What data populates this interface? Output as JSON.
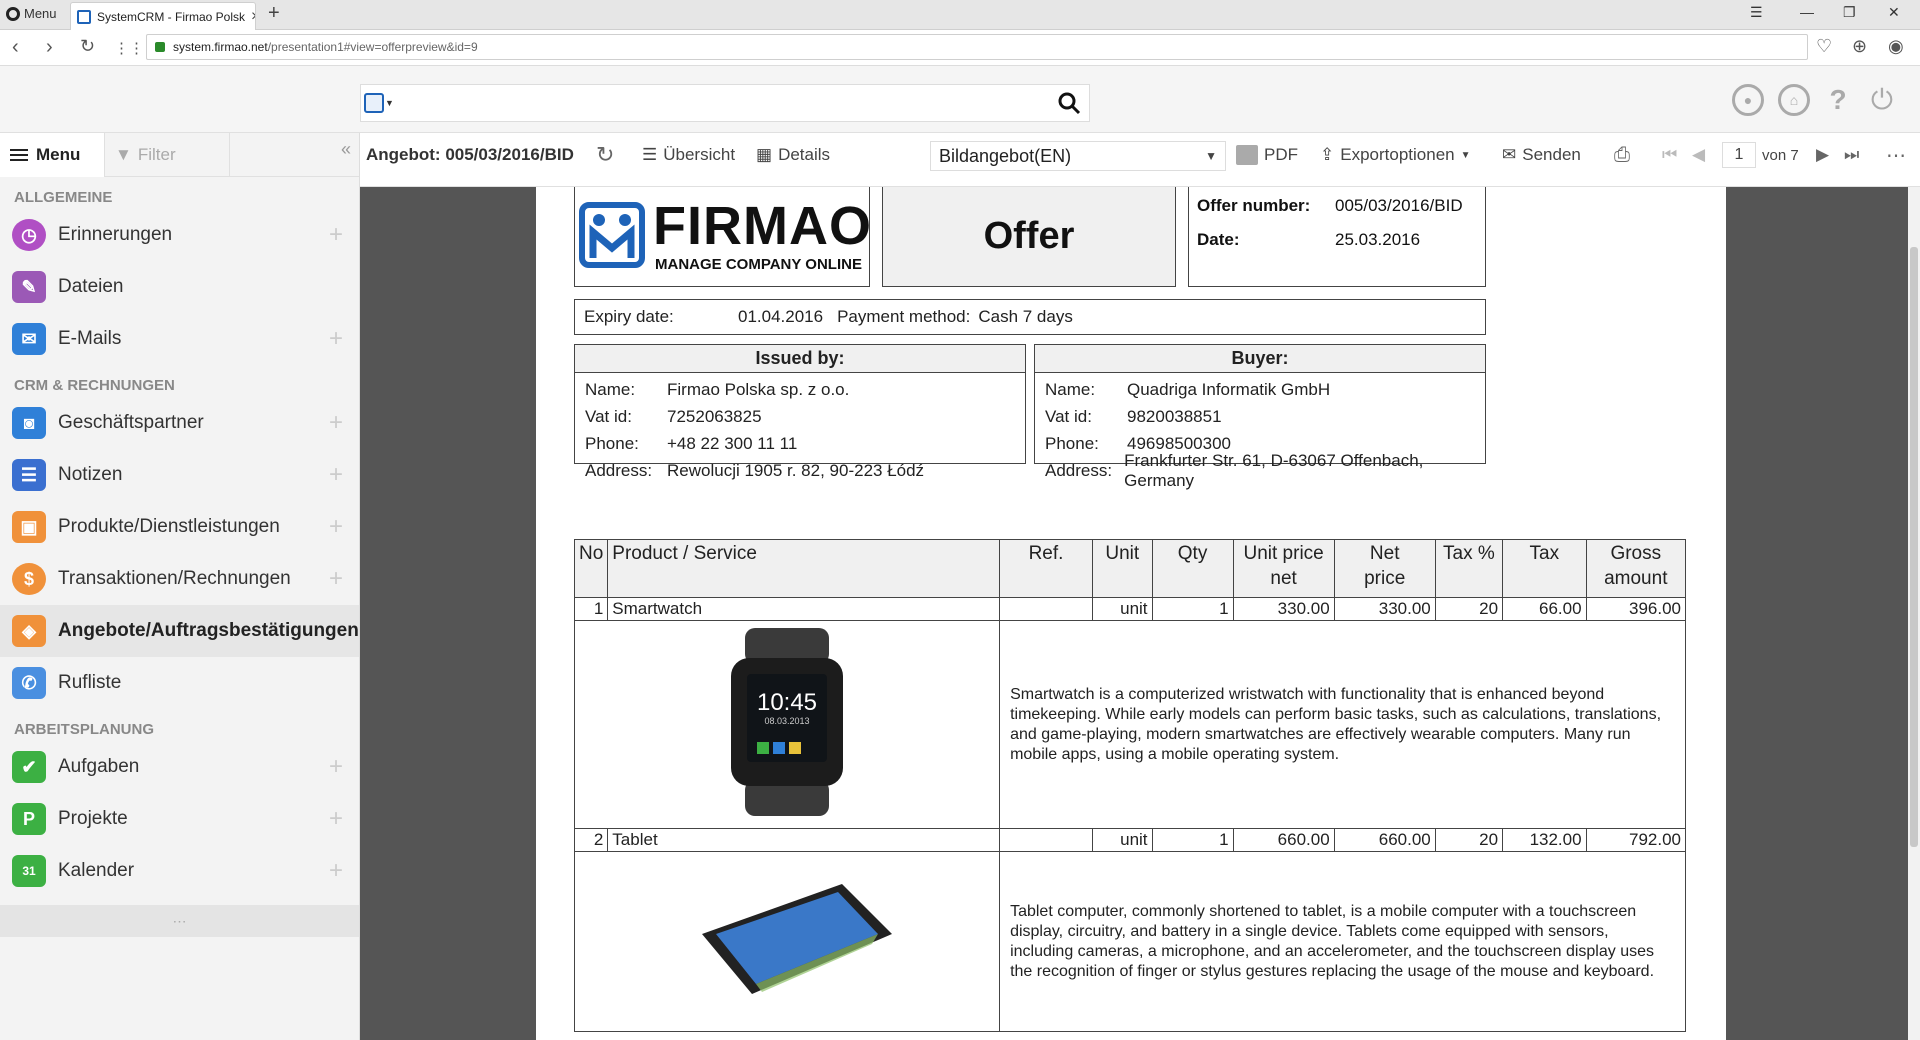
{
  "browser": {
    "menu_label": "Menu",
    "tab_title": "SystemCRM - Firmao Polsk",
    "url_host": "system.firmao.net",
    "url_path": "/presentation1#view=offerpreview&id=9"
  },
  "header": {
    "search_placeholder": ""
  },
  "sidebar": {
    "menu_label": "Menu",
    "filter_label": "Filter",
    "sections": {
      "general": "ALLGEMEINE",
      "crm": "CRM & RECHNUNGEN",
      "planning": "ARBEITSPLANUNG"
    },
    "items": {
      "reminders": "Erinnerungen",
      "files": "Dateien",
      "emails": "E-Mails",
      "partners": "Geschäftspartner",
      "notes": "Notizen",
      "products": "Produkte/Dienstleistungen",
      "transactions": "Transaktionen/Rechnungen",
      "offers": "Angebote/Auftragsbestätigungen",
      "calls": "Rufliste",
      "tasks": "Aufgaben",
      "projects": "Projekte",
      "calendar": "Kalender"
    },
    "more": "⋯"
  },
  "toolbar": {
    "title": "Angebot: 005/03/2016/BID",
    "overview": "Übersicht",
    "details": "Details",
    "template": "Bildangebot(EN)",
    "pdf": "PDF",
    "export": "Exportoptionen",
    "send": "Senden",
    "page_current": "1",
    "page_total": "von 7"
  },
  "document": {
    "logo_word": "FIRMAO",
    "logo_tagline": "MANAGE COMPANY ONLINE",
    "title": "Offer",
    "offer_number_label": "Offer number:",
    "offer_number": "005/03/2016/BID",
    "date_label": "Date:",
    "date": "25.03.2016",
    "expiry_label": "Expiry date:",
    "expiry": "01.04.2016",
    "payment_label": "Payment method:",
    "payment": "Cash 7 days",
    "issuer": {
      "heading": "Issued by:",
      "name_label": "Name:",
      "name": "Firmao Polska sp. z o.o.",
      "vat_label": "Vat id:",
      "vat": "7252063825",
      "phone_label": "Phone:",
      "phone": "+48 22 300 11 11",
      "address_label": "Address:",
      "address": "Rewolucji 1905 r. 82, 90-223 Łódź"
    },
    "buyer": {
      "heading": "Buyer:",
      "name_label": "Name:",
      "name": "Quadriga Informatik GmbH",
      "vat_label": "Vat id:",
      "vat": "9820038851",
      "phone_label": "Phone:",
      "phone": "49698500300",
      "address_label": "Address:",
      "address": "Frankfurter Str. 61, D-63067 Offenbach, Germany"
    },
    "columns": {
      "no": "No",
      "product": "Product / Service",
      "ref": "Ref.",
      "unit": "Unit",
      "qty": "Qty",
      "unit_price_net_1": "Unit price",
      "unit_price_net_2": "net",
      "net_price_1": "Net",
      "net_price_2": "price",
      "tax_pct": "Tax %",
      "tax": "Tax",
      "gross_1": "Gross",
      "gross_2": "amount"
    },
    "items": [
      {
        "no": "1",
        "product": "Smartwatch",
        "ref": "",
        "unit": "unit",
        "qty": "1",
        "unit_price": "330.00",
        "net_price": "330.00",
        "tax_pct": "20",
        "tax": "66.00",
        "gross": "396.00",
        "watch_time": "10:45",
        "watch_date": "08.03.2013",
        "description": "Smartwatch is a computerized wristwatch with functionality that is enhanced beyond timekeeping. While early models can perform basic tasks, such as calculations, translations, and game-playing, modern smartwatches are effectively wearable computers. Many run mobile apps, using a mobile operating system."
      },
      {
        "no": "2",
        "product": "Tablet",
        "ref": "",
        "unit": "unit",
        "qty": "1",
        "unit_price": "660.00",
        "net_price": "660.00",
        "tax_pct": "20",
        "tax": "132.00",
        "gross": "792.00",
        "description": "Tablet computer, commonly shortened to tablet, is a mobile computer with a touchscreen display, circuitry, and battery in a single device. Tablets come equipped with sensors, including cameras, a microphone, and an accelerometer, and the touchscreen display uses the recognition of finger or stylus gestures replacing the usage of the mouse and keyboard."
      }
    ]
  },
  "colors": {
    "brand_blue": "#1e63b8",
    "sidebar_bg": "#f3f3f3",
    "viewer_bg": "#555555",
    "accent_orange": "#f0913a",
    "green": "#3cb043"
  }
}
